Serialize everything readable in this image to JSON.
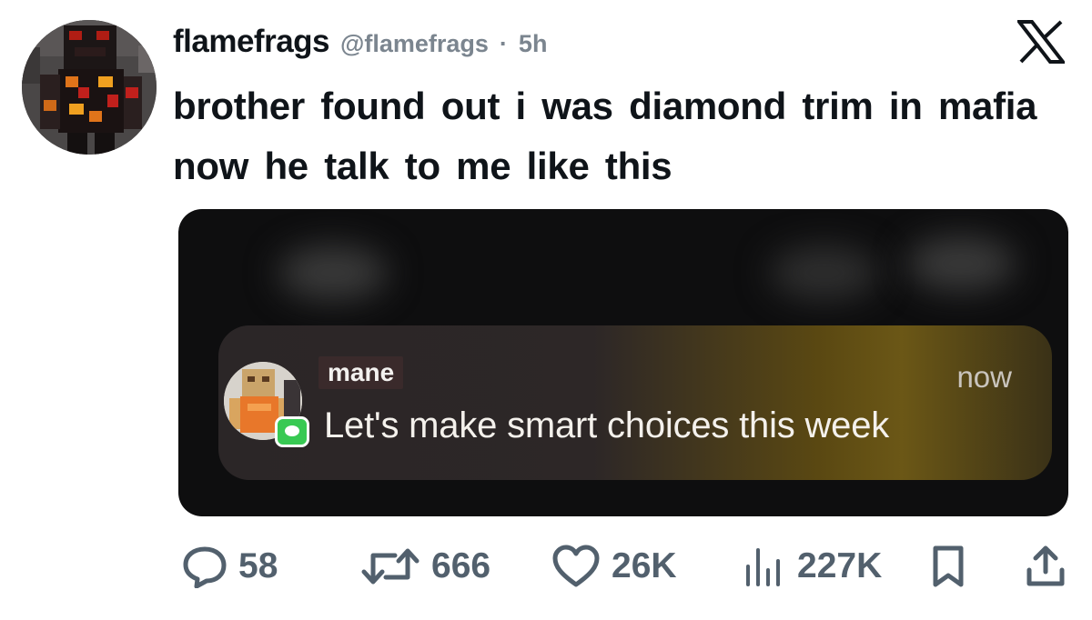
{
  "tweet": {
    "display_name": "flamefrags",
    "handle": "@flamefrags",
    "separator": "·",
    "time": "5h",
    "text": "brother found out i was diamond trim in mafia now he talk to me like this"
  },
  "notification": {
    "sender": "mane",
    "time": "now",
    "body": "Let's make smart choices this week"
  },
  "actions": {
    "replies": "58",
    "retweets": "666",
    "likes": "26K",
    "views": "227K"
  },
  "icons": [
    "x-logo-icon",
    "reply-icon",
    "retweet-icon",
    "like-icon",
    "views-icon",
    "bookmark-icon",
    "share-icon",
    "messages-icon"
  ],
  "colors": {
    "accent_gray": "#52606d",
    "messages_green": "#38c953"
  }
}
